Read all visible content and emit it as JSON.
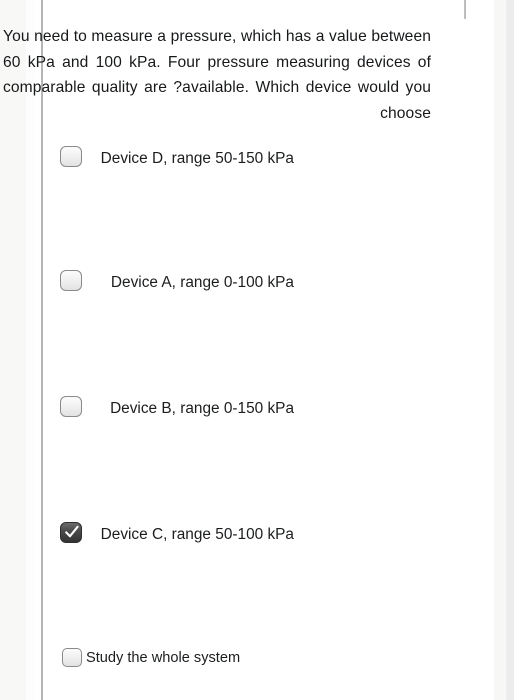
{
  "question": {
    "text": "You need to measure a pressure, which has a value between 60 kPa and 100 kPa. Four pressure measuring devices of comparable quality are ?available. Which device would you choose"
  },
  "options": [
    {
      "id": "device-d",
      "label": "Device D, range 50-150 kPa",
      "checked": false
    },
    {
      "id": "device-a",
      "label": "Device A, range 0-100 kPa",
      "checked": false
    },
    {
      "id": "device-b",
      "label": "Device B, range 0-150 kPa",
      "checked": false
    },
    {
      "id": "device-c",
      "label": "Device C, range 50-100 kPa",
      "checked": true
    },
    {
      "id": "study-whole-system",
      "label": "Study the whole system",
      "checked": false
    }
  ],
  "colors": {
    "page_background": "#ffffff",
    "text": "#16181a",
    "rule": "#9b9b9b",
    "checkbox_border": "#8a8a8a",
    "checkbox_fill": "#efefef",
    "checkbox_checked_fill": "#3a3a3a",
    "checkmark": "#ffffff"
  }
}
